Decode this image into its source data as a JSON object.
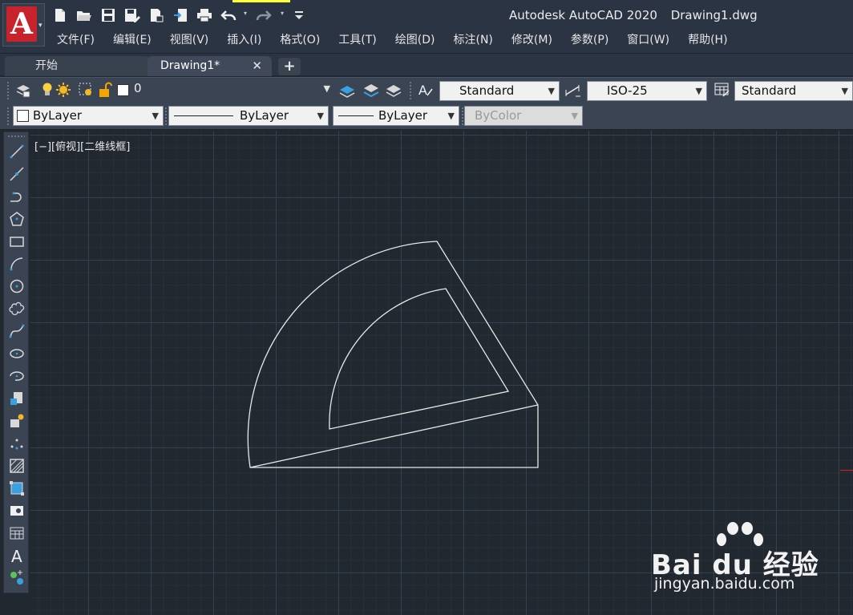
{
  "app": {
    "name": "Autodesk AutoCAD 2020",
    "file": "Drawing1.dwg",
    "logo_letter": "A"
  },
  "menu": [
    "文件(F)",
    "编辑(E)",
    "视图(V)",
    "插入(I)",
    "格式(O)",
    "工具(T)",
    "绘图(D)",
    "标注(N)",
    "修改(M)",
    "参数(P)",
    "窗口(W)",
    "帮助(H)"
  ],
  "quick_access": [
    "new-icon",
    "open-icon",
    "save-icon",
    "save-as-icon",
    "publish-icon",
    "import-icon",
    "plot-icon",
    "undo-icon",
    "redo-icon",
    "customize-icon"
  ],
  "tabs": {
    "start": "开始",
    "drawing": "Drawing1*",
    "close": "✕",
    "add": "+"
  },
  "layer_toolbar": {
    "layer_value": "0",
    "text_style": "Standard",
    "dim_style": "ISO-25",
    "table_style": "Standard"
  },
  "properties_toolbar": {
    "color": "ByLayer",
    "linetype": "ByLayer",
    "lineweight": "ByLayer",
    "plot_style": "ByColor"
  },
  "left_tools": [
    "line-icon",
    "construction-line-icon",
    "polyline-icon",
    "polygon-icon",
    "rectangle-icon",
    "arc-icon",
    "circle-icon",
    "revision-cloud-icon",
    "spline-icon",
    "ellipse-icon",
    "ellipse-arc-icon",
    "insert-block-icon",
    "make-block-icon",
    "point-icon",
    "hatch-icon",
    "region-icon",
    "wipeout-icon",
    "table-icon",
    "mtext-icon",
    "add-selected-icon"
  ],
  "viewport": {
    "label": "[−][俯视][二维线框]"
  },
  "colors": {
    "canvas": "#212830",
    "line": "#e8e8e8",
    "accent_red": "#c8232c"
  },
  "watermark": {
    "brand": "Bai du 经验",
    "url": "jingyan.baidu.com"
  }
}
